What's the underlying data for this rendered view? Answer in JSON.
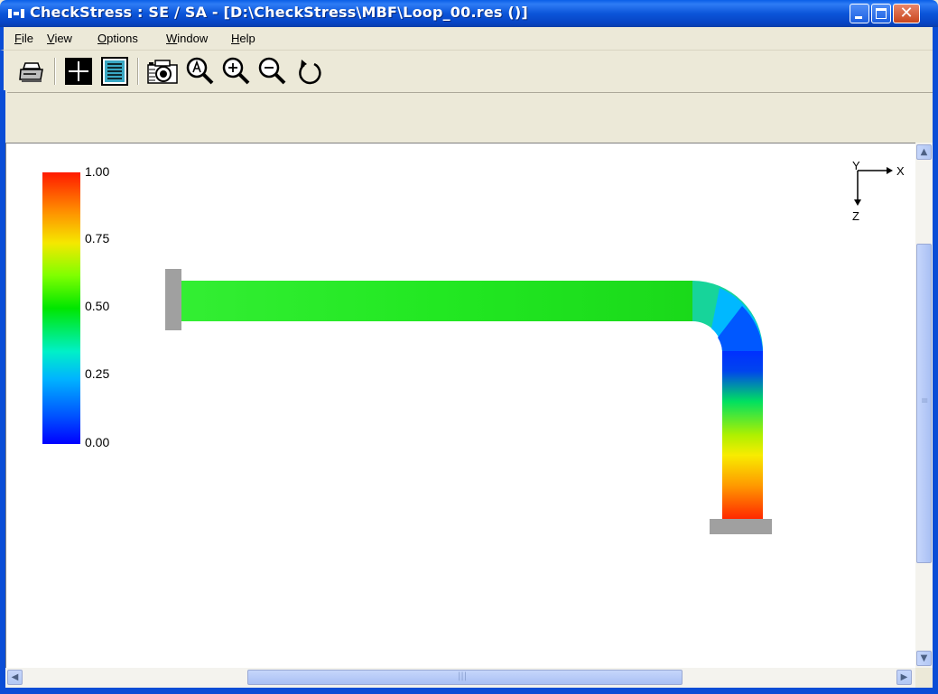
{
  "window": {
    "title": "CheckStress : SE / SA -  [D:\\CheckStress\\MBF\\Loop_00.res ()]",
    "close_glyph": "✕"
  },
  "menu": {
    "items": [
      {
        "label": "File",
        "mnemonic": "F"
      },
      {
        "label": "View",
        "mnemonic": "V"
      },
      {
        "label": "Options",
        "mnemonic": "O"
      },
      {
        "label": "Window",
        "mnemonic": "W"
      },
      {
        "label": "Help",
        "mnemonic": "H"
      }
    ]
  },
  "toolbar": {
    "buttons": [
      {
        "icon": "printer-icon"
      },
      {
        "icon": "crosshair-view-icon"
      },
      {
        "icon": "document-view-icon"
      },
      {
        "icon": "camera-icon"
      },
      {
        "icon": "zoom-auto-icon"
      },
      {
        "icon": "zoom-in-icon"
      },
      {
        "icon": "zoom-out-icon"
      },
      {
        "icon": "rotate-icon"
      }
    ]
  },
  "legend": {
    "labels": [
      "1.00",
      "0.75",
      "0.50",
      "0.25",
      "0.00"
    ],
    "colors": [
      "#ff1a00",
      "#ff8c00",
      "#f5e800",
      "#00e600",
      "#00b4ff",
      "#0000ff"
    ]
  },
  "axes": {
    "x_label": "X",
    "y_label": "Y",
    "z_label": "Z"
  },
  "scroll": {
    "v_grip": "≡",
    "h_grip": "|||"
  }
}
